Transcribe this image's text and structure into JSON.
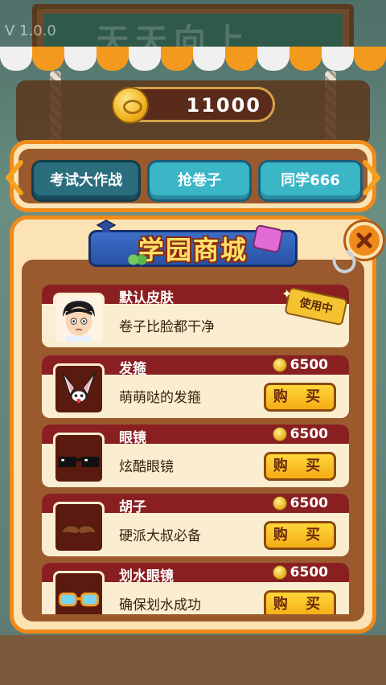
{
  "version": "V 1.0.0",
  "background_board_text": "天天向上",
  "coins": {
    "amount": "11000"
  },
  "tabs": [
    {
      "label": "考试大作战",
      "active": true
    },
    {
      "label": "抢卷子",
      "active": false
    },
    {
      "label": "同学666",
      "active": false
    }
  ],
  "shop": {
    "title": "学园商城",
    "items": [
      {
        "name": "默认皮肤",
        "desc": "卷子比脸都干净",
        "price": "",
        "buy_label": "",
        "badge": "使用中",
        "thumb_icon": "student-face-icon"
      },
      {
        "name": "发箍",
        "desc": "萌萌哒的发箍",
        "price": "6500",
        "buy_label": "购 买",
        "badge": "",
        "thumb_icon": "bunny-ears-icon"
      },
      {
        "name": "眼镜",
        "desc": "炫酷眼镜",
        "price": "6500",
        "buy_label": "购 买",
        "badge": "",
        "thumb_icon": "sunglasses-icon"
      },
      {
        "name": "胡子",
        "desc": "硬派大叔必备",
        "price": "6500",
        "buy_label": "购 买",
        "badge": "",
        "thumb_icon": "mustache-icon"
      },
      {
        "name": "划水眼镜",
        "desc": "确保划水成功",
        "price": "6500",
        "buy_label": "购 买",
        "badge": "",
        "thumb_icon": "goggles-icon"
      }
    ]
  },
  "colors": {
    "accent_orange": "#f08a1a",
    "tab_teal": "#3ab6c6",
    "item_header": "#8a1f22",
    "buy_yellow": "#f4ad14"
  }
}
